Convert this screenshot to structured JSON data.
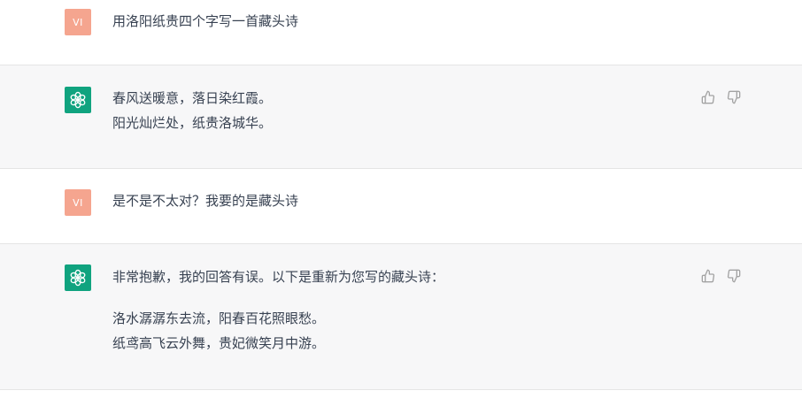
{
  "conversation": {
    "messages": [
      {
        "role": "user",
        "avatar_initials": "VI",
        "lines": [
          "用洛阳纸贵四个字写一首藏头诗"
        ]
      },
      {
        "role": "assistant",
        "avatar_icon": "openai-logo-icon",
        "lines": [
          "春风送暖意，落日染红霞。",
          "阳光灿烂处，纸贵洛城华。"
        ]
      },
      {
        "role": "user",
        "avatar_initials": "VI",
        "lines": [
          "是不是不太对？我要的是藏头诗"
        ]
      },
      {
        "role": "assistant",
        "avatar_icon": "openai-logo-icon",
        "lines": [
          "非常抱歉，我的回答有误。以下是重新为您写的藏头诗：",
          "洛水潺潺东去流，阳春百花照眼愁。",
          "纸鸢高飞云外舞，贵妃微笑月中游。"
        ]
      }
    ]
  },
  "colors": {
    "user_avatar": "#f5a58f",
    "assistant_avatar": "#10a37f",
    "assistant_bg": "#f7f7f8",
    "icon_gray": "#a3a3a3"
  },
  "icons": {
    "thumbs_up": "thumbs-up-icon",
    "thumbs_down": "thumbs-down-icon"
  }
}
